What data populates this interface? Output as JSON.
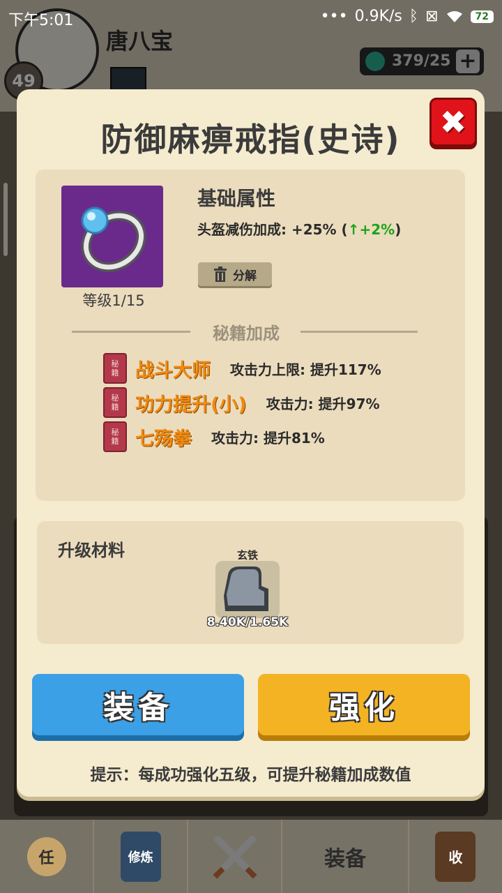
{
  "status_bar": {
    "time": "下午5:01",
    "network_speed": "0.9K/s",
    "battery": "72"
  },
  "player": {
    "name": "唐八宝",
    "level": "49"
  },
  "resources": {
    "energy": "379/25"
  },
  "dialog": {
    "title": "防御麻痹戒指(史诗)",
    "item_level": "等级1/15",
    "attributes": {
      "heading": "基础属性",
      "line_prefix": "头盔减伤加成: +25% (",
      "bonus": "↑+2%",
      "line_suffix": ")"
    },
    "decompose_label": "分解",
    "secret_section_label": "秘籍加成",
    "book_badge": [
      "秘",
      "籍"
    ],
    "skills": [
      {
        "name": "战斗大师",
        "effect": "攻击力上限: 提升117%"
      },
      {
        "name": "功力提升(小)",
        "effect": "攻击力: 提升97%"
      },
      {
        "name": "七殇拳",
        "effect": "攻击力: 提升81%"
      }
    ],
    "materials": {
      "heading": "升级材料",
      "item_name": "玄铁",
      "count": "8.40K/1.65K"
    },
    "equip_label": "装备",
    "enhance_label": "强化",
    "hint": "提示：每成功强化五级，可提升秘籍加成数值"
  },
  "bottom_nav": {
    "task_glyph": "任",
    "training_glyph": "修炼",
    "equipment_label": "装备",
    "collect_glyph": "收"
  },
  "colors": {
    "dialog_bg": "#f5ebcf",
    "skill_name": "#f08a12",
    "bonus_green": "#1ba41b",
    "equip_button": "#3ba0e6",
    "enhance_button": "#f4b323",
    "close_button": "#e1131a",
    "item_rarity_bg": "#6a2a8c"
  }
}
